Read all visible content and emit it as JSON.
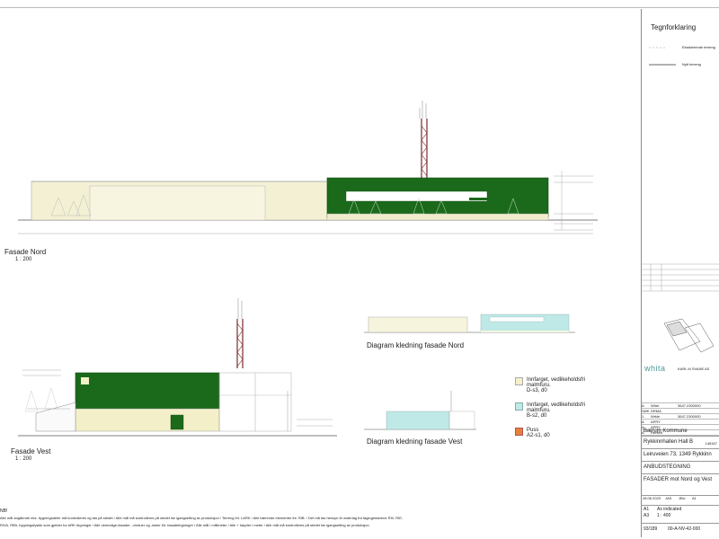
{
  "legend": {
    "heading": "Tegnforklaring",
    "existing_terrain": "Eksisterende terreng",
    "new_terrain": "Nytt terreng"
  },
  "views": {
    "nord_title": "Fasade Nord",
    "nord_scale": "1 : 200",
    "vest_title": "Fasade Vest",
    "vest_scale": "1 : 200",
    "diagram_nord": "Diagram kledning fasade Nord",
    "diagram_vest": "Diagram kledning fasade Vest"
  },
  "materials": [
    {
      "line1": "Innfarget, vedlikeholdsfri",
      "line2": "malmfuru.",
      "line3": "D-s3, d0",
      "color": "#f5f0c8"
    },
    {
      "line1": "Innfarget, vedlikeholdsfri",
      "line2": "malmfuru.",
      "line3": "B-s2, d0",
      "color": "#bfe9e6"
    },
    {
      "line1": "Puss",
      "line2": "",
      "line3": "A2-s1, d0",
      "color": "#e8803a"
    }
  ],
  "notes": {
    "nb": "NB!",
    "line1": "Alle mål angående eks. bygningsdeler må kontrolleres og tas på stedet / Alle mål må kontrolleres på stedet før igangsetting av produksjon / Terreng iht. LARK / Alle bærende elementer iht. RIB. / Det må tas hensyn til underlag fra fagingeniørene RIV, RIE,",
    "line2": "RIVA, RIBr, bygningsfysikk som gjelder for ARK tegninger / Alle utvendige-fasader, -vinduer og -dører iht. fasadetegninger / Alle mål i millimeter / Alle + høyder i meter / Alle mål må kontrolleres på stedet før igangsetting av produksjon"
  },
  "title_block": {
    "logo": "whita",
    "logo_sub": "KARL M SVANE AS",
    "revisions": [
      {
        "rev": "A",
        "desc": "Wher",
        "ref": "3647.2300000"
      },
      {
        "rev": "SØK",
        "desc": "DRMA",
        "ref": ""
      },
      {
        "rev": "1",
        "desc": "Wrkle",
        "ref": "3647.2300000"
      },
      {
        "rev": "A",
        "desc": "APRY",
        "ref": ""
      },
      {
        "rev": "A",
        "desc": "APRY",
        "ref": ""
      },
      {
        "rev": "A",
        "desc": "Rerttelt",
        "ref": ""
      }
    ],
    "client": "Bærum Kommune",
    "project": "Rykkinnhallen Hall B",
    "project_no": "148167",
    "address": "Leiruveien 73, 1349 Rykkinn",
    "status": "ANBUDSTEGNING",
    "drawing_title": "FASADER mot Nord og Vest",
    "date": "28.06.2023",
    "drawn": "JAS",
    "checked": "JBU",
    "approved": "A1",
    "paper1": "A1",
    "scale1": "As indicated",
    "paper3": "A3",
    "scale3": "1 : 400",
    "sheet": "93/189",
    "drawing_no": "00-A-NV-42-000"
  }
}
